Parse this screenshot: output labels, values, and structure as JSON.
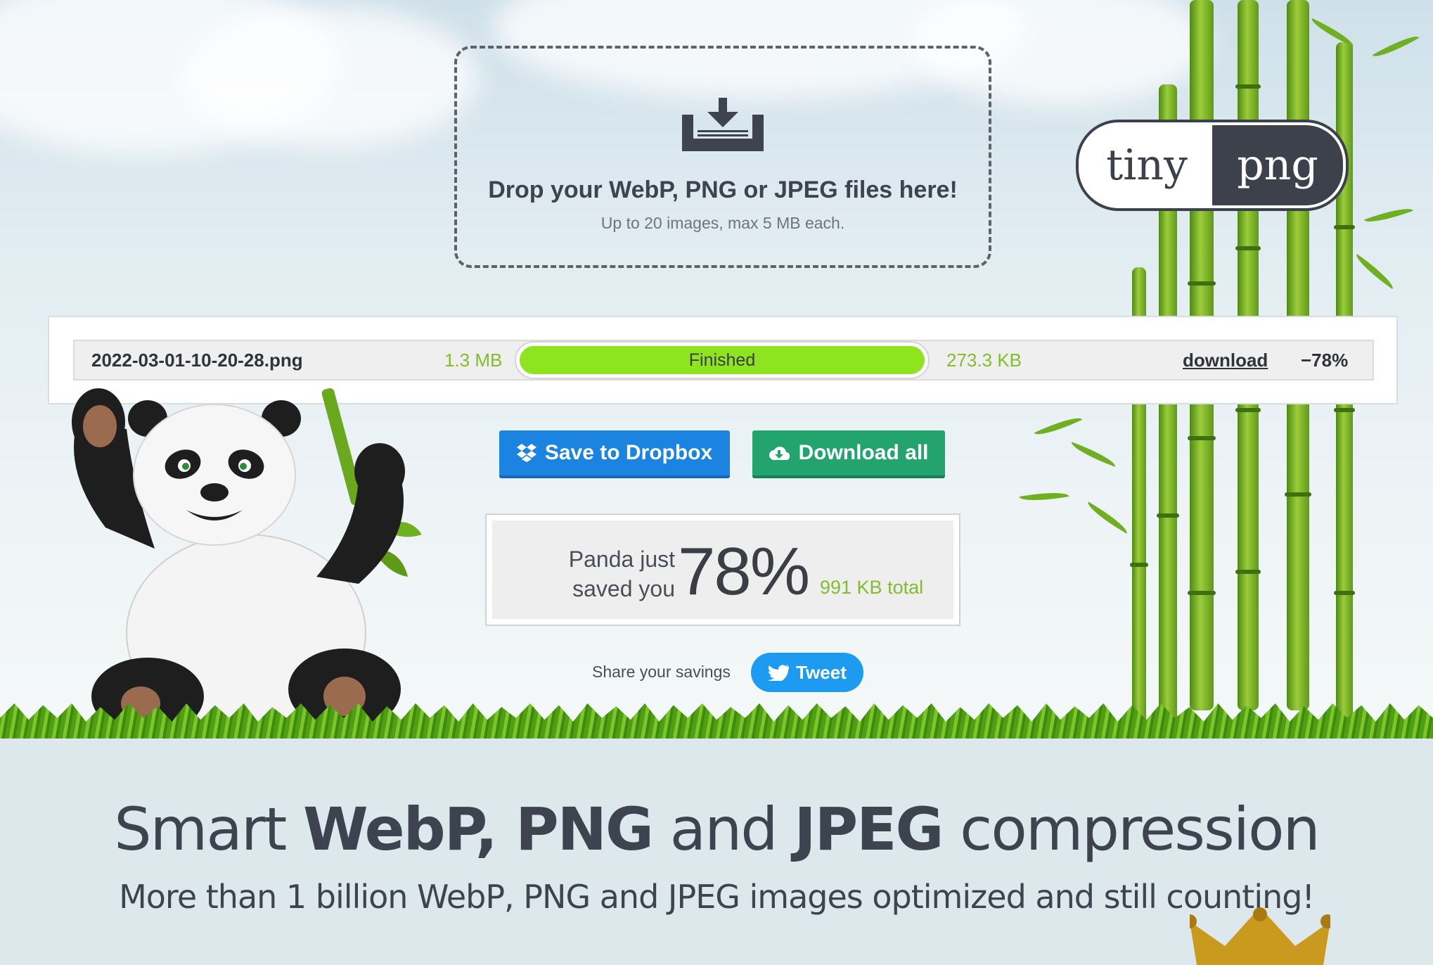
{
  "dropzone": {
    "title": "Drop your WebP, PNG or JPEG files here!",
    "subtitle": "Up to 20 images, max 5 MB each.",
    "icon": "upload-tray-icon"
  },
  "logo": {
    "part1": "tiny",
    "part2": "png"
  },
  "results": [
    {
      "filename": "2022-03-01-10-20-28.png",
      "original_size": "1.3 MB",
      "status": "Finished",
      "progress": 1.0,
      "new_size": "273.3 KB",
      "download_label": "download",
      "reduction": "−78%"
    }
  ],
  "buttons": {
    "dropbox": {
      "label": "Save to Dropbox",
      "icon": "dropbox-icon",
      "color": "#1a84e0"
    },
    "download_all": {
      "label": "Download all",
      "icon": "cloud-download-icon",
      "color": "#23a36e"
    }
  },
  "savings": {
    "label_line1": "Panda just",
    "label_line2": "saved you",
    "percent": "78%",
    "total": "991 KB total"
  },
  "share": {
    "label": "Share your savings",
    "tweet_label": "Tweet",
    "tweet_icon": "twitter-bird-icon",
    "tweet_color": "#1d9bf0"
  },
  "headline": {
    "prefix": "Smart ",
    "bold1": "WebP, PNG",
    "mid": " and ",
    "bold2": "JPEG",
    "suffix": " compression",
    "subtitle": "More than 1 billion WebP, PNG and JPEG images optimized and still counting!"
  },
  "colors": {
    "accent_green": "#82bd2c",
    "progress_fill": "#8ee41e",
    "dark_text": "#3e4350"
  }
}
